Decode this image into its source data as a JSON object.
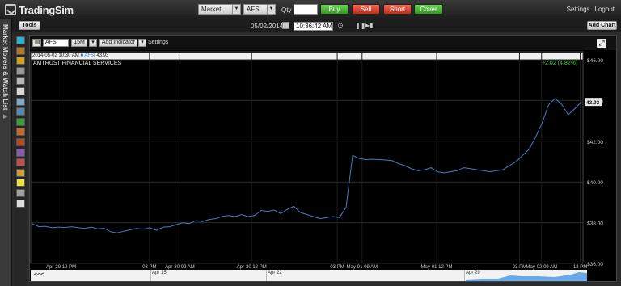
{
  "app": {
    "name": "TradingSim"
  },
  "order": {
    "type": "Market",
    "symbol": "AFSI",
    "qty_label": "Qty",
    "qty_value": "",
    "buttons": {
      "buy": "Buy",
      "sell": "Sell",
      "short": "Short",
      "cover": "Cover"
    },
    "colors": {
      "buy": "#3cad2a",
      "sell": "#d63b26",
      "short": "#d63b26",
      "cover": "#3cad2a"
    }
  },
  "top_links": {
    "settings": "Settings",
    "logout": "Logout"
  },
  "toolbar": {
    "tools_label": "Tools",
    "date": "05/02/2014",
    "time": "10:36:42 AM",
    "add_chart_label": "Add Chart"
  },
  "sidebar": {
    "label": "Market Movers & Watch List",
    "expand_icon": "triangle-right-icon"
  },
  "tools": [
    "crosshair-icon",
    "fib-icon",
    "trendline-icon",
    "ray-icon",
    "text-tool-icon",
    "hline-icon",
    "channel-icon",
    "rectangle-icon",
    "ellipse-icon",
    "arrow-icon",
    "pitchfork-icon",
    "gann-icon",
    "fib-fan-icon",
    "fib-arc-icon",
    "measure-icon",
    "pencil-icon",
    "eraser-icon"
  ],
  "chart_panel": {
    "symbol_box_icon": "chart-type-icon",
    "symbol": "AFSI",
    "interval": "15M",
    "add_indicator_label": "Add Indicator",
    "settings_label": "Settings",
    "info_timestamp": "2014-05-02 10:30 AM",
    "info_symbol": "AFSI",
    "info_price": "43.93",
    "company_name": "AMTRUST FINANCIAL SERVICES",
    "change_text": "+2.02 (4.82%)",
    "nav_back": "<<<",
    "nav_labels": [
      "Apr 15",
      "Apr 22",
      "Apr 29"
    ]
  },
  "chart_data": {
    "type": "line",
    "series": [
      {
        "values": [
          37.95,
          37.8,
          37.82,
          37.75,
          37.78,
          37.76,
          37.8,
          37.75,
          37.72,
          37.78,
          37.7,
          37.72,
          37.55,
          37.5,
          37.58,
          37.65,
          37.72,
          37.68,
          37.75,
          37.62,
          37.78,
          37.8,
          37.9,
          38.0,
          37.95,
          38.1,
          38.05,
          38.15,
          38.2,
          38.3,
          38.35,
          38.3,
          38.4,
          38.3,
          38.35,
          38.6,
          38.55,
          38.62,
          38.45,
          38.65,
          38.8,
          38.5,
          38.4,
          38.3,
          38.2,
          38.25,
          38.3,
          38.25,
          38.75,
          41.3,
          41.15,
          41.1,
          41.12,
          41.1,
          41.08,
          41.05,
          40.9,
          40.8,
          40.65,
          40.55,
          40.6,
          40.7,
          40.5,
          40.45,
          40.5,
          40.55,
          40.7,
          40.65,
          40.6,
          40.55,
          40.5,
          40.55,
          40.6,
          40.8,
          41.0,
          41.3,
          41.6,
          42.2,
          42.9,
          43.8,
          44.1,
          43.8,
          43.3,
          43.6,
          43.93
        ]
      }
    ],
    "y_ticks": [
      "$46.00",
      "$44.00",
      "$42.00",
      "$40.00",
      "$38.00",
      "$36.00"
    ],
    "ylim": [
      36,
      46
    ],
    "last_price_label": "43.93",
    "x_labels": [
      {
        "label": "Apr-29 12 PM",
        "pos": 0.055
      },
      {
        "label": "03 PM",
        "pos": 0.215
      },
      {
        "label": "Apr-30 09 AM",
        "pos": 0.27
      },
      {
        "label": "Apr-30 12 PM",
        "pos": 0.4
      },
      {
        "label": "03 PM",
        "pos": 0.555
      },
      {
        "label": "May-01 09 AM",
        "pos": 0.6
      },
      {
        "label": "May-01 12 PM",
        "pos": 0.735
      },
      {
        "label": "03 PM",
        "pos": 0.885
      },
      {
        "label": "May-02 09 AM",
        "pos": 0.925
      },
      {
        "label": "12 PM",
        "pos": 0.995
      }
    ],
    "line_color": "#3f7fc4"
  }
}
